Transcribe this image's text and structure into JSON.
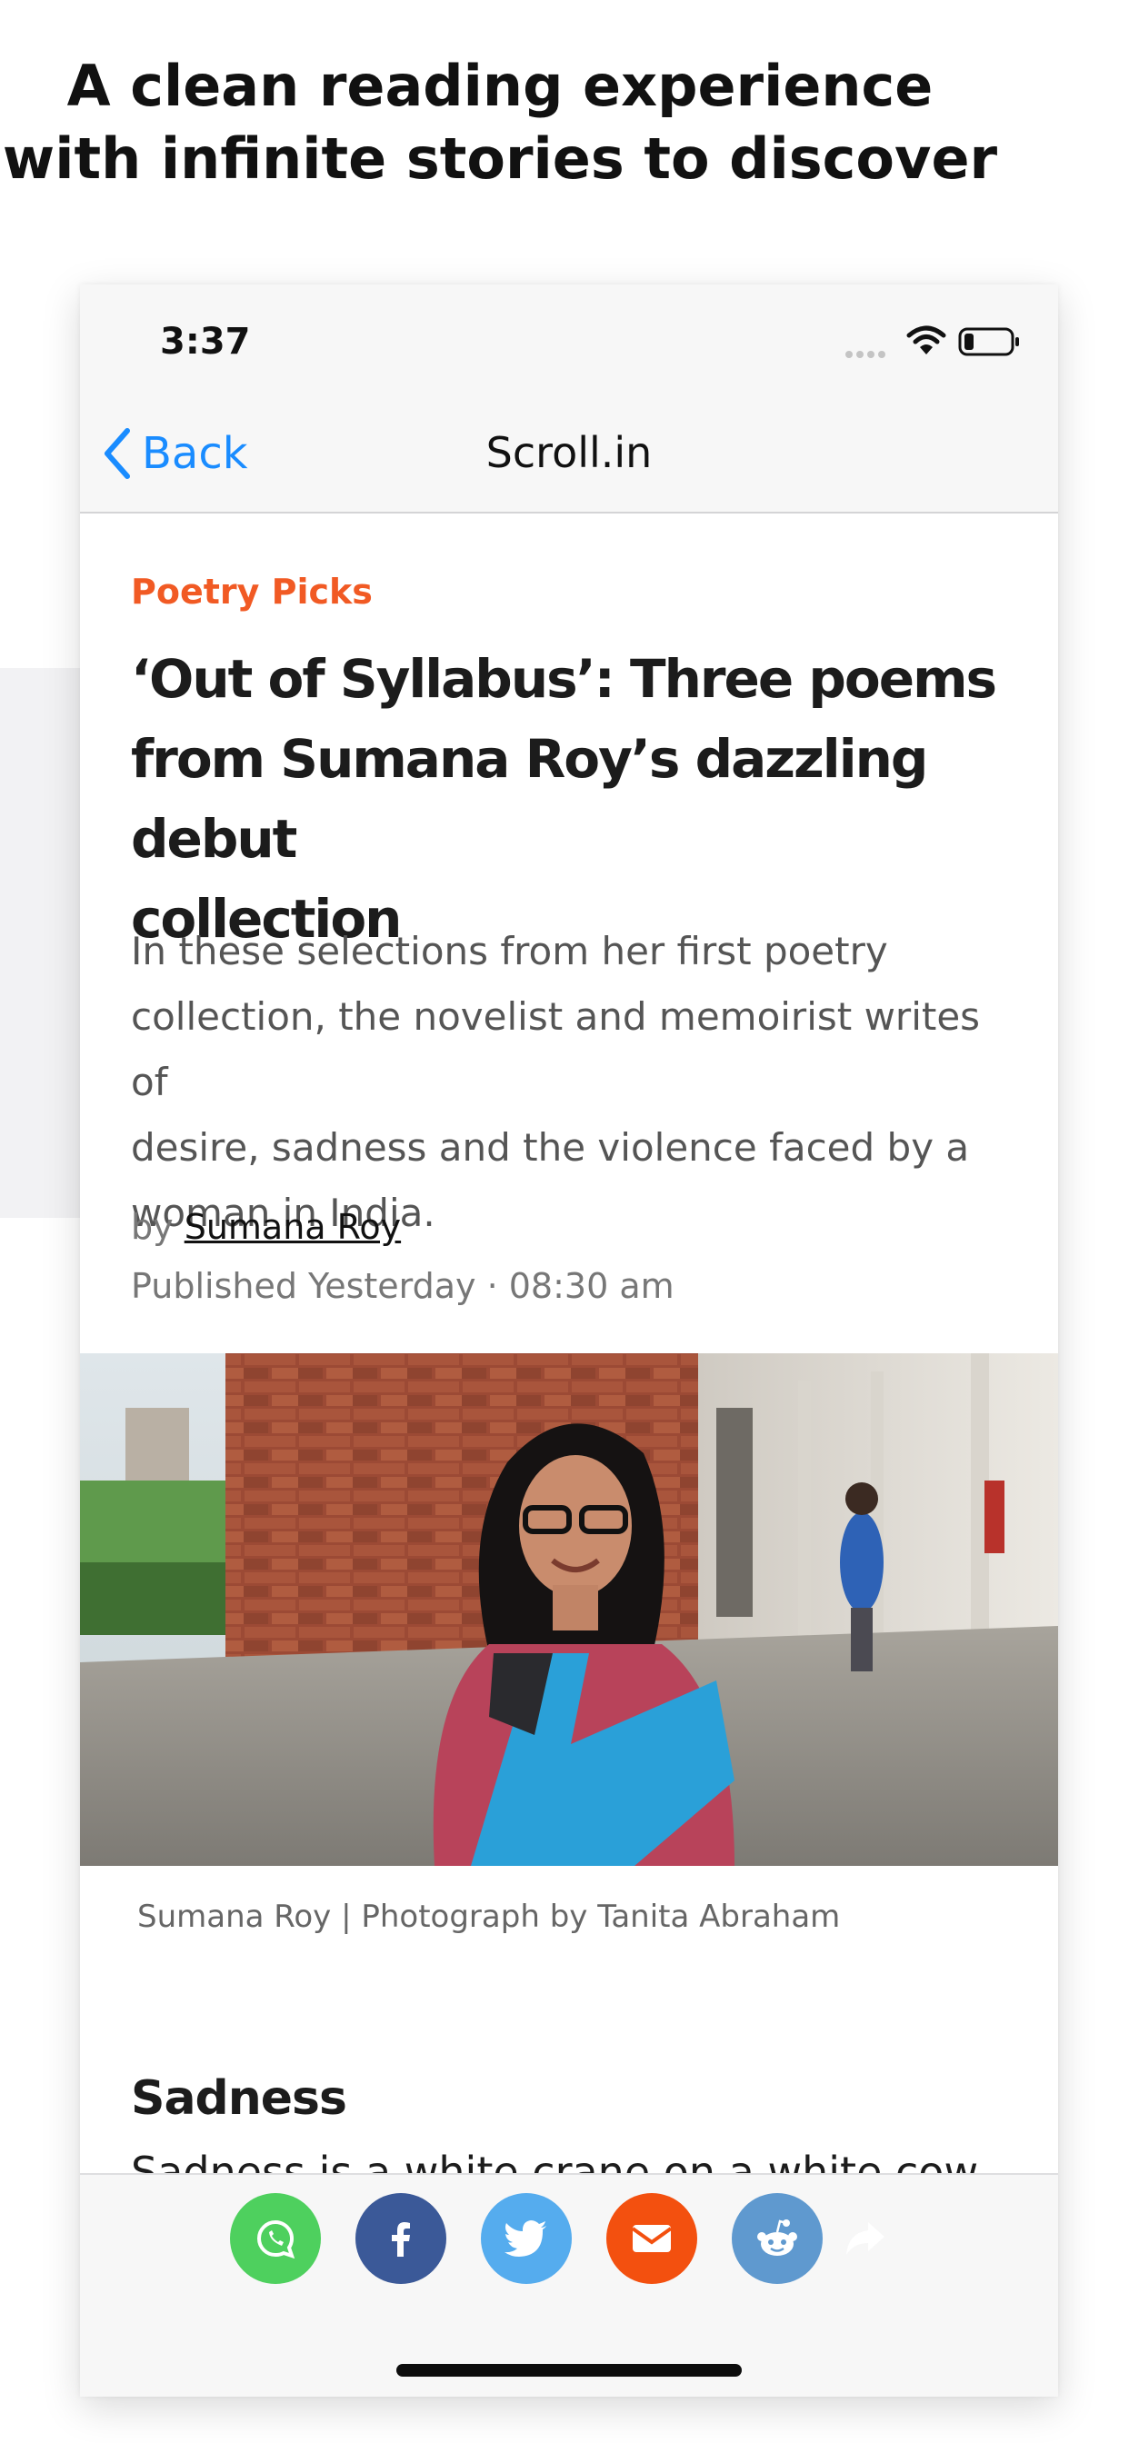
{
  "promo": {
    "line1": "A clean reading experience",
    "line2": "with infinite stories to discover"
  },
  "status_bar": {
    "time": "3:37",
    "icons": [
      "signal-dots-icon",
      "wifi-icon",
      "battery-icon"
    ],
    "battery_level": 0.2
  },
  "nav": {
    "back_label": "Back",
    "title": "Scroll.in"
  },
  "article": {
    "category": "Poetry Picks",
    "headline_lines": [
      "‘Out of Syllabus’: Three poems",
      "from Sumana Roy’s dazzling debut",
      "collection"
    ],
    "summary_lines": [
      "In these selections from her first poetry",
      "collection, the novelist and memoirist writes of",
      "desire, sadness and the violence faced by a",
      "woman in India."
    ],
    "by_prefix": "by",
    "author": "Sumana Roy",
    "published": "Published Yesterday · 08:30 am",
    "photo_caption": "Sumana Roy | Photograph by Tanita Abraham",
    "section_heading": "Sadness",
    "body_peek": "Sadness is a white crane on a white cow"
  },
  "share_bar": {
    "buttons": [
      {
        "name": "whatsapp",
        "icon": "whatsapp-icon",
        "color": "#4ed05e"
      },
      {
        "name": "facebook",
        "icon": "facebook-icon",
        "color": "#3b5998"
      },
      {
        "name": "twitter",
        "icon": "twitter-icon",
        "color": "#55acee"
      },
      {
        "name": "email",
        "icon": "envelope-icon",
        "color": "#f3500f"
      },
      {
        "name": "reddit",
        "icon": "reddit-icon",
        "color": "#5f99cf"
      },
      {
        "name": "more-share",
        "icon": "share-arrow-icon",
        "color": "#2f2f2f"
      }
    ]
  },
  "colors": {
    "accent_orange": "#f15a24",
    "ios_blue": "#1a8cff"
  }
}
